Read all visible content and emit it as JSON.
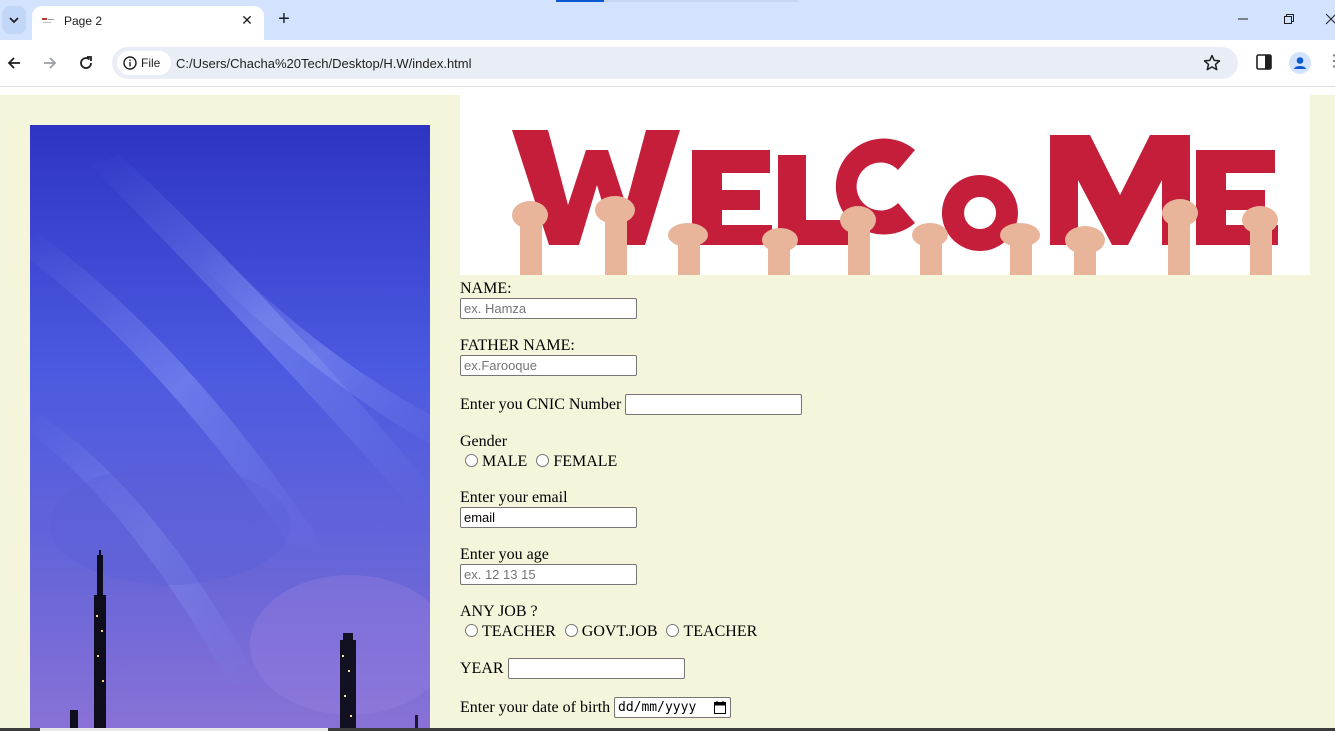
{
  "browser": {
    "tab": {
      "title": "Page 2"
    },
    "address": {
      "chip_label": "File",
      "url": "C:/Users/Chacha%20Tech/Desktop/H.W/index.html"
    },
    "accent_color": "#0b57d0"
  },
  "page": {
    "background": "#f5f5dc",
    "banner_alt": "WELCOME",
    "form": {
      "name": {
        "label": "NAME:",
        "placeholder": "ex. Hamza"
      },
      "father_name": {
        "label": "FATHER NAME:",
        "placeholder": "ex.Farooque"
      },
      "cnic": {
        "label": "Enter you CNIC Number",
        "value": ""
      },
      "gender": {
        "label": "Gender",
        "options": [
          "MALE",
          "FEMALE"
        ]
      },
      "email": {
        "label": "Enter your email",
        "value": "email"
      },
      "age": {
        "label": "Enter you age",
        "placeholder": "ex. 12 13 15"
      },
      "job": {
        "label": "ANY JOB ?",
        "options": [
          "TEACHER",
          "GOVT.JOB",
          "TEACHER"
        ]
      },
      "year": {
        "label": "YEAR",
        "value": ""
      },
      "dob": {
        "label": "Enter your date of birth",
        "placeholder": "dd/mm/yyyy"
      }
    }
  }
}
